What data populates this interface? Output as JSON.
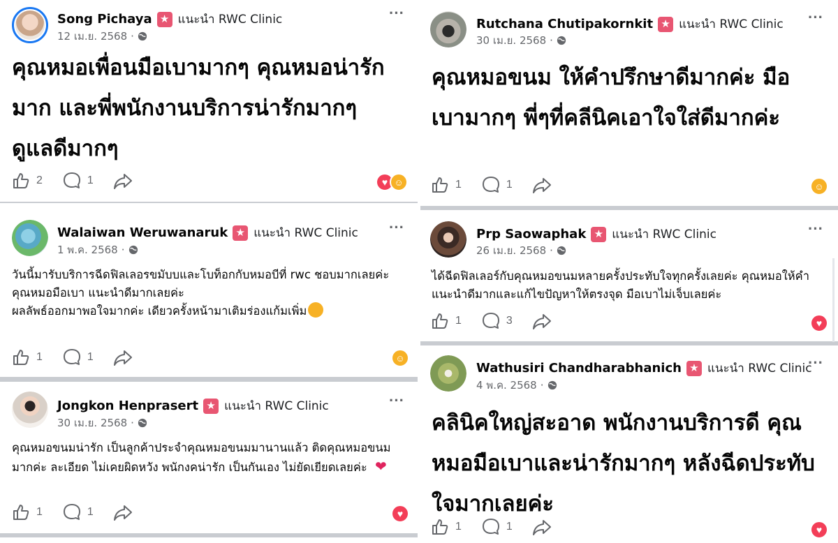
{
  "brand": {
    "badge_color": "#e85672",
    "love_color": "#f33e58",
    "care_color": "#f7b125",
    "meta_color": "#65676b"
  },
  "icons": {
    "badge": "star-badge-icon",
    "globe": "globe-icon",
    "like": "like-icon",
    "comment": "comment-icon",
    "share": "share-icon",
    "more": "more-icon",
    "love": "love-reaction-icon",
    "care": "care-reaction-icon"
  },
  "posts": [
    {
      "name": "Song Pichaya",
      "recommend": "แนะนำ RWC Clinic",
      "date": "12 เม.ย. 2568",
      "text": "คุณหมอเพื่อนมือเบามากๆ คุณหมอน่ารักมาก และพี่พนักงานบริการน่ารักมากๆ ดูแลดีมากๆ",
      "likes": "2",
      "comments": "1"
    },
    {
      "name": "Walaiwan Weruwanaruk",
      "recommend": "แนะนำ RWC Clinic",
      "date": "1 พ.ค. 2568",
      "lines": [
        "วันนี้มารับบริการฉีดฟิลเลอรขมับบและโบท็อกกับหมอบีที่ rwc ชอบมากเลยค่ะ",
        "คุณหมอมือเบา แนะนำดีมากเลยค่ะ",
        "ผลลัพธ์ออกมาพอใจมากค่ะ เดียวครั้งหน้ามาเติมร่องแก้มเพิ่ม"
      ],
      "likes": "1",
      "comments": "1"
    },
    {
      "name": "Jongkon Henprasert",
      "recommend": "แนะนำ RWC Clinic",
      "date": "30 เม.ย. 2568",
      "text": "คุณหมอขนมน่ารัก เป็นลูกค้าประจำคุณหมอขนมมานานแล้ว ติดคุณหมอขนมมากค่ะ ละเอียด ไม่เคยผิดหวัง พนักงคน่ารัก เป็นกันเอง ไม่ยัดเยียดเลยค่ะ",
      "heart": "❤",
      "likes": "1",
      "comments": "1"
    },
    {
      "name": "Rutchana Chutipakornkit",
      "recommend": "แนะนำ RWC Clinic",
      "date": "30 เม.ย. 2568",
      "text": "คุณหมอขนม ให้คำปรึกษาดีมากค่ะ มือเบามากๆ พี่ๆที่คลีนิคเอาใจใส่ดีมากค่ะ",
      "likes": "1",
      "comments": "1"
    },
    {
      "name": "Prp Saowaphak",
      "recommend": "แนะนำ RWC Clinic",
      "date": "26 เม.ย. 2568",
      "text": "ได้ฉีดฟิลเลอร์กับคุณหมอขนมหลายครั้งประทับใจทุกครั้งเลยค่ะ คุณหมอให้คำแนะนำดีมากและแก้ไขปัญหาให้ตรงจุด มือเบาไม่เจ็บเลยค่ะ",
      "likes": "1",
      "comments": "3"
    },
    {
      "name": "Wathusiri Chandharabhanich",
      "recommend": "แนะนำ RWC Clinic",
      "date": "4 พ.ค. 2568",
      "text": "คลินิคใหญ่สะอาด พนักงานบริการดี คุณหมอมือเบาและน่ารักมากๆ หลังฉีดประทับใจมากเลยค่ะ",
      "likes": "1",
      "comments": "1"
    }
  ]
}
